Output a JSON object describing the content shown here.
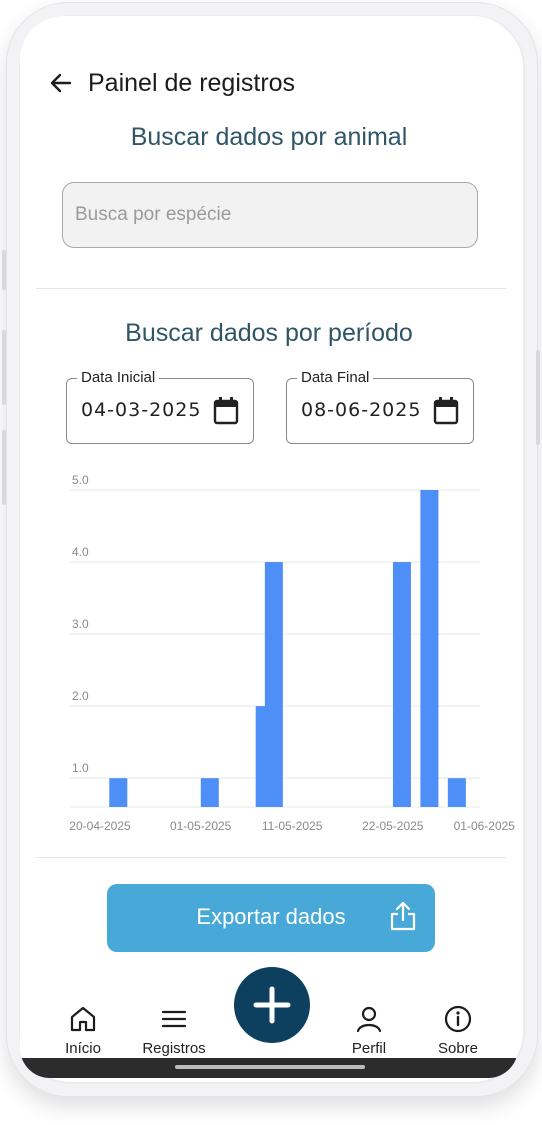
{
  "header": {
    "title": "Painel de registros"
  },
  "animal_search": {
    "title": "Buscar dados por animal",
    "placeholder": "Busca por espécie",
    "value": ""
  },
  "period_search": {
    "title": "Buscar dados por período",
    "start_label": "Data Inicial",
    "start_value": "04-03-2025",
    "end_label": "Data Final",
    "end_value": "08-06-2025"
  },
  "chart_data": {
    "type": "bar",
    "title": "",
    "xlabel": "",
    "ylabel": "",
    "ylim": [
      0.6,
      5.0
    ],
    "y_ticks": [
      "1.0",
      "2.0",
      "3.0",
      "4.0",
      "5.0"
    ],
    "x_tick_labels": [
      "20-04-2025",
      "01-05-2025",
      "11-05-2025",
      "22-05-2025",
      "01-06-2025"
    ],
    "bars": [
      {
        "date": "22-04-2025",
        "value": 1
      },
      {
        "date": "02-05-2025",
        "value": 1
      },
      {
        "date": "08-05-2025",
        "value": 2
      },
      {
        "date": "09-05-2025",
        "value": 4
      },
      {
        "date": "23-05-2025",
        "value": 4
      },
      {
        "date": "26-05-2025",
        "value": 5
      },
      {
        "date": "29-05-2025",
        "value": 1
      }
    ],
    "grid": true,
    "bar_color": "#4d8ef7"
  },
  "actions": {
    "export_label": "Exportar dados"
  },
  "nav": {
    "home": "Início",
    "records": "Registros",
    "profile": "Perfil",
    "about": "Sobre"
  },
  "colors": {
    "accent_dark": "#0d3f5f",
    "export_button": "#48a9d9",
    "section_title": "#2f5566"
  }
}
